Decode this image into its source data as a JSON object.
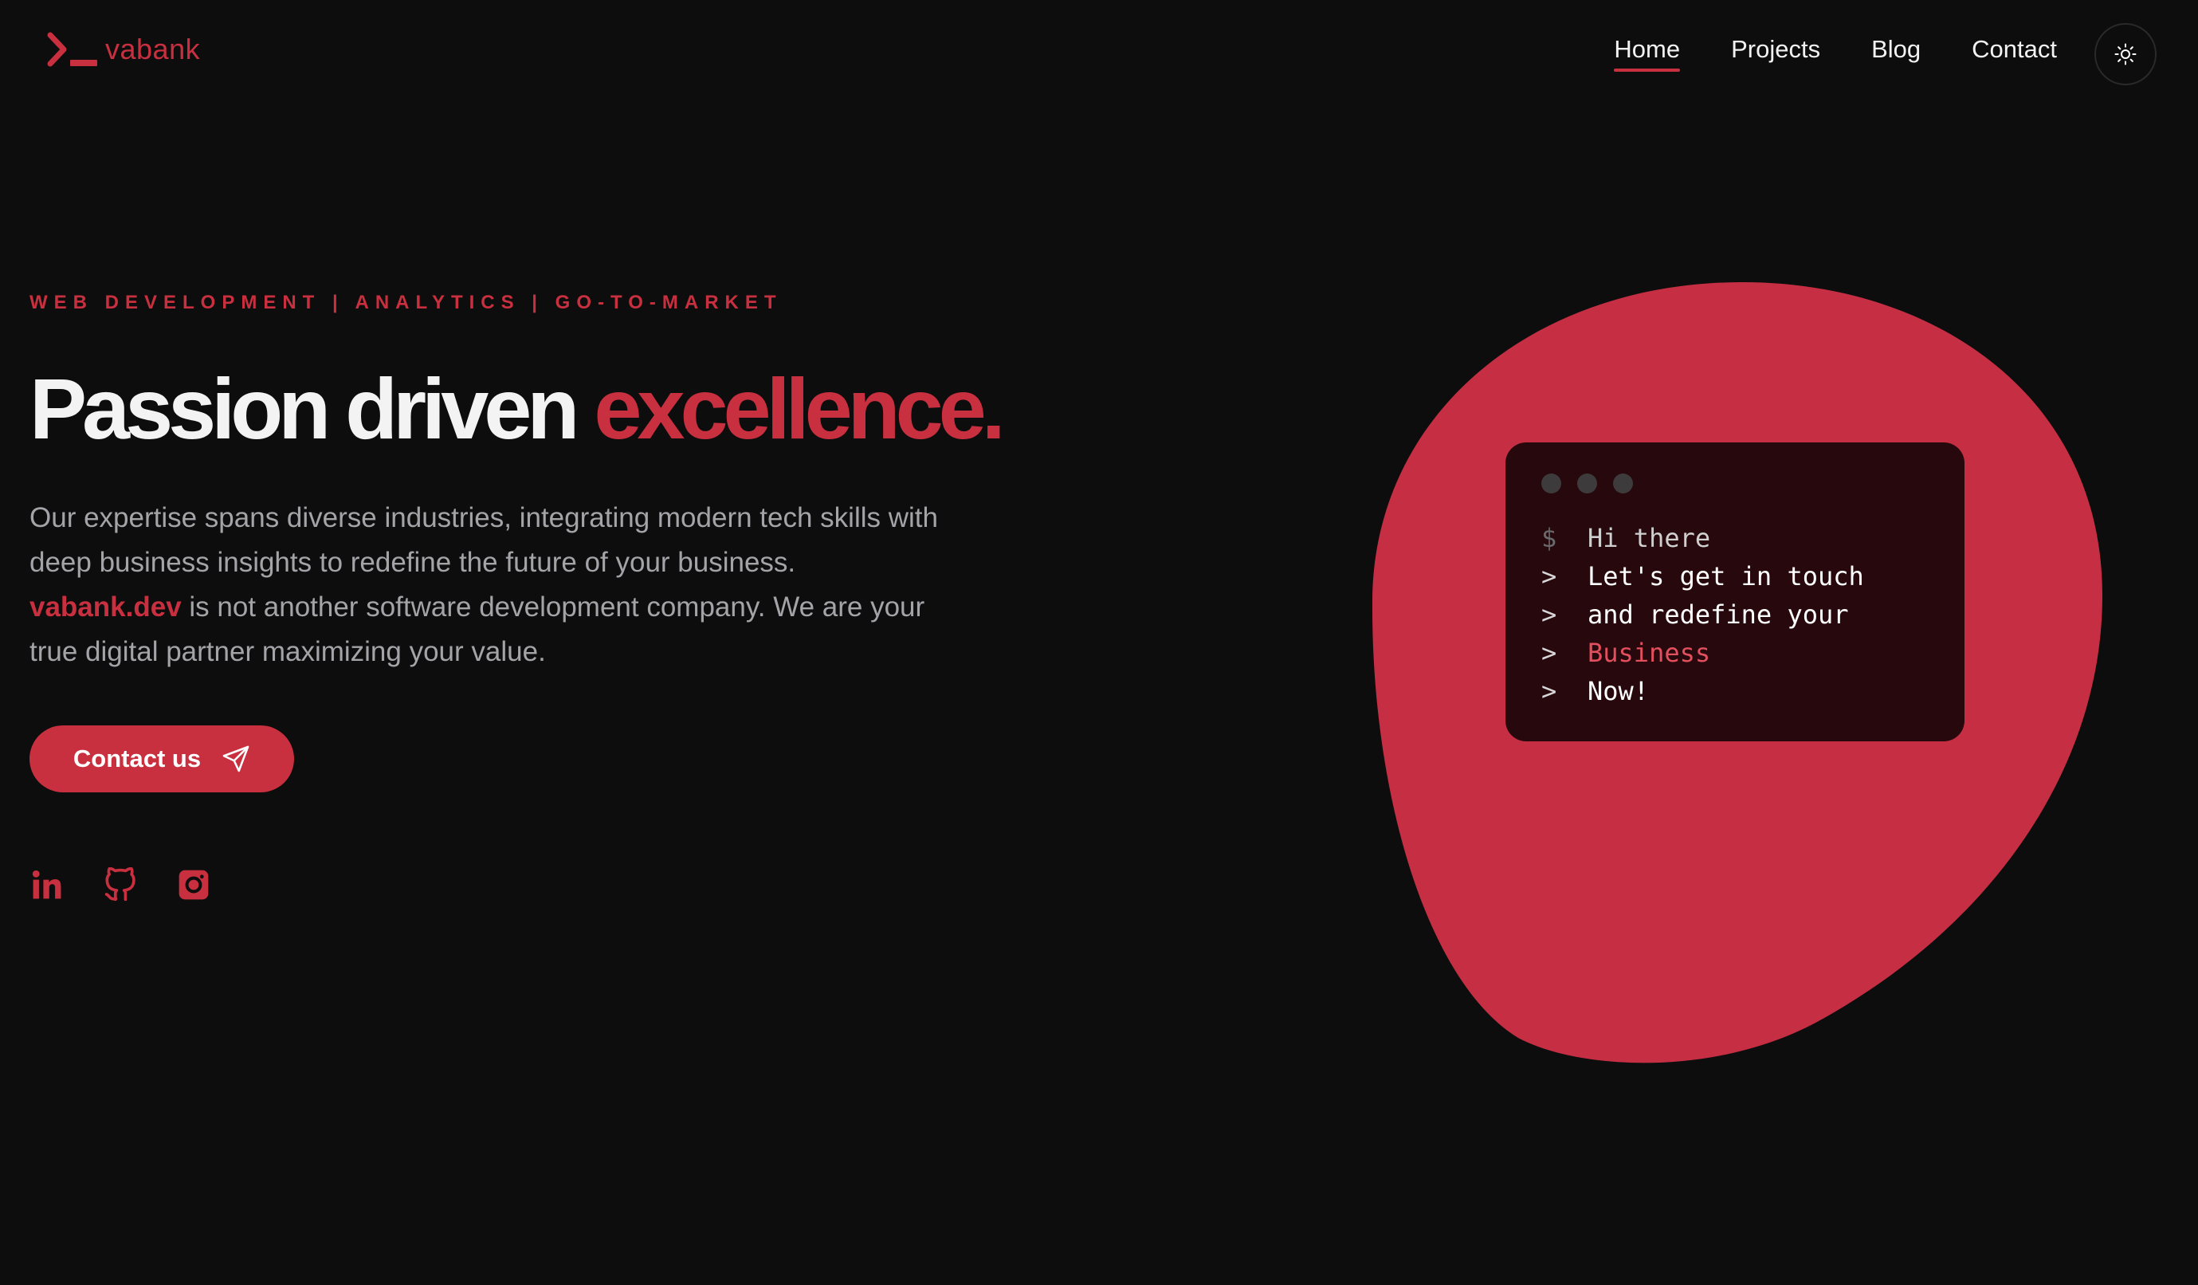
{
  "header": {
    "logo_text": "vabank",
    "nav": [
      {
        "label": "Home",
        "active": true
      },
      {
        "label": "Projects",
        "active": false
      },
      {
        "label": "Blog",
        "active": false
      },
      {
        "label": "Contact",
        "active": false
      }
    ],
    "theme_toggle_icon": "sun-icon"
  },
  "hero": {
    "eyebrow": "WEB DEVELOPMENT | ANALYTICS | GO-TO-MARKET",
    "headline_main": "Passion driven",
    "headline_accent": "excellence.",
    "intro_text": "Our expertise spans diverse industries, integrating modern tech skills with deep business insights to redefine the future of your business.",
    "intro_brand": "vabank.dev",
    "intro_rest": " is not another software development company. We are your true digital partner maximizing your value.",
    "cta_label": "Contact us",
    "cta_icon": "paper-plane-icon"
  },
  "socials": [
    {
      "name": "linkedin-icon"
    },
    {
      "name": "github-icon"
    },
    {
      "name": "instagram-icon"
    }
  ],
  "terminal": {
    "lines": [
      {
        "prompt": "$",
        "text": "Hi there",
        "style": "dim"
      },
      {
        "prompt": ">",
        "text": "Let's get in touch",
        "style": "normal"
      },
      {
        "prompt": ">",
        "text": "and redefine your",
        "style": "normal"
      },
      {
        "prompt": ">",
        "text": "Business",
        "style": "accent"
      },
      {
        "prompt": ">",
        "text": "Now!",
        "style": "normal"
      }
    ]
  },
  "colors": {
    "background": "#0d0d0e",
    "accent": "#c8303f",
    "terminal_bg": "#26080d",
    "body_text": "#a4a4a8"
  }
}
